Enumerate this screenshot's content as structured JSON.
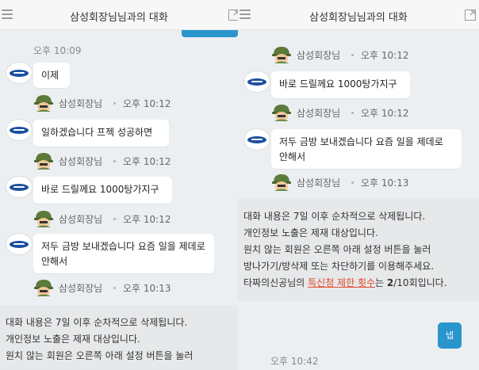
{
  "left": {
    "title": "삼성회장님님과의 대화",
    "top_time": "오후 10:09",
    "messages": [
      {
        "text": "이제",
        "sender": "삼성회장님",
        "time": "오후 10:12"
      },
      {
        "text": "일하겠습니다 프젝 성공하면",
        "sender": "삼성회장님",
        "time": "오후 10:12"
      },
      {
        "text": "바로 드릴께요 1000탕가지구",
        "sender": "삼성회장님",
        "time": "오후 10:12"
      },
      {
        "text": "저두 금방 보내겠습니다 요즘 일을 제데로 안해서",
        "sender": "삼성회장님",
        "time": "오후 10:13"
      }
    ],
    "notice": {
      "line1": "대화 내용은 7일 이후 순차적으로 삭제됩니다.",
      "line2": "개인정보 노출은 제재 대상입니다.",
      "line3": "원치 않는 회원은 오른쪽 아래 설정 버튼을 눌러"
    }
  },
  "right": {
    "title": "삼성회장님님과의 대화",
    "meta_top": {
      "sender": "삼성회장님",
      "time": "오후 10:12"
    },
    "messages": [
      {
        "text": "바로 드릴께요 1000탕가지구",
        "sender": "삼성회장님",
        "time": "오후 10:12"
      },
      {
        "text": "저두 금방 보내겠습니다 요즘 일을 제데로 안해서",
        "sender": "삼성회장님",
        "time": "오후 10:13"
      }
    ],
    "notice": {
      "line1": "대화 내용은 7일 이후 순차적으로 삭제됩니다.",
      "line2": "개인정보 노출은 제재 대상입니다.",
      "line3": "원치 않는 회원은 오른쪽 아래 설정 버튼을 눌러",
      "line4": "방나가기/방삭제 또는 차단하기를 이용해주세요.",
      "line5_pre": "타짜의신공님의 ",
      "line5_link": "특신청 제한 횟수",
      "line5_mid": "는 ",
      "line5_count": "2",
      "line5_post": "/10회입니다."
    },
    "my_message": {
      "text": "넵",
      "time": "오후 10:42"
    }
  },
  "colors": {
    "my_bubble": "#2a95cc",
    "highlight": "#e24a2e",
    "background": "#eceff1"
  },
  "icons": {
    "menu": "hamburger-icon",
    "expand": "expand-icon",
    "avatar": "samsung-logo-avatar",
    "sender_avatar": "soldier-avatar-icon"
  }
}
